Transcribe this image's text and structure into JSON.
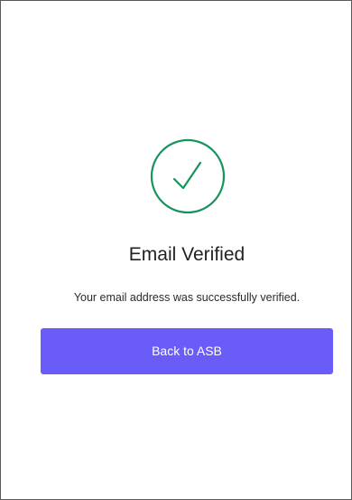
{
  "colors": {
    "accent": "#6a5cf7",
    "success": "#16935a",
    "text": "#222222"
  },
  "icon": {
    "name": "checkmark-circle-icon"
  },
  "verification": {
    "title": "Email Verified",
    "message": "Your email address was successfully verified.",
    "button_label": "Back to ASB"
  }
}
